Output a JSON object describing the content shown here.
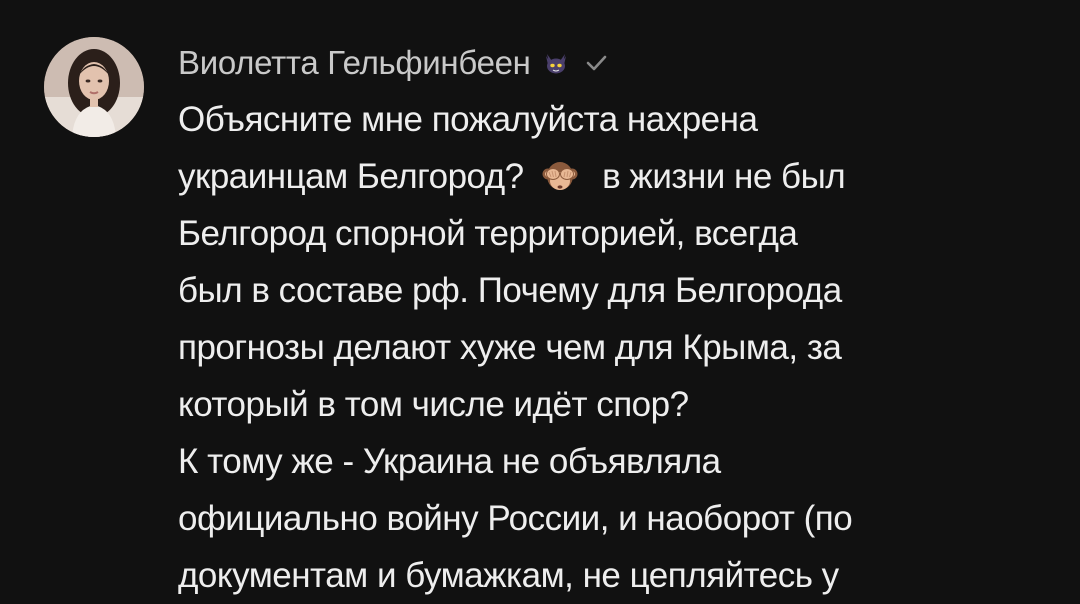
{
  "comment": {
    "author": {
      "name": "Виолетта Гельфинбеен",
      "badge_icon": "cat-face-icon",
      "verified_icon": "check-icon"
    },
    "avatar_icon": "user-avatar",
    "text": {
      "line_1": "Объясните мне пожалуйста нахрена",
      "line_2_before": "украинцам Белгород?",
      "line_2_emoji": "see-no-evil-monkey-icon",
      "line_2_after": "в жизни не был",
      "line_3": "Белгород спорной территорией, всегда",
      "line_4": "был в составе рф. Почему для Белгорода",
      "line_5": "прогнозы делают хуже чем для Крыма, за",
      "line_6": "который в том числе идёт спор?",
      "line_7": "К тому же - Украина не объявляла",
      "line_8": "официально войну России, и наоборот (по",
      "line_9": "документам и бумажкам, не цепляйтесь у"
    }
  },
  "colors": {
    "background": "#111111",
    "author": "#c9c9c9",
    "text": "#eeeeee"
  }
}
